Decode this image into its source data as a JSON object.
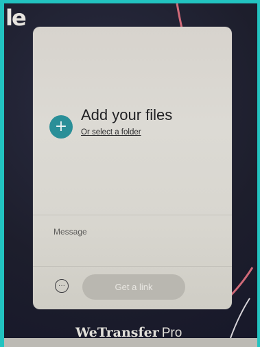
{
  "app": {
    "logo_fragment": "le"
  },
  "upload": {
    "add_icon": "plus-icon",
    "add_icon_glyph": "+",
    "title": "Add your files",
    "select_folder_link": "Or select a folder"
  },
  "form": {
    "message_placeholder": "Message",
    "more_icon": "more-options-icon",
    "more_icon_glyph": "···",
    "submit_label": "Get a link"
  },
  "brand": {
    "name": "WeTransfer",
    "suffix": "Pro"
  },
  "colors": {
    "accent": "#2a8f98",
    "panel_background": "#d8d6cf",
    "screen_background": "#1d1e2c",
    "frame": "#22c3c0",
    "button_disabled": "#b9b7b0"
  }
}
